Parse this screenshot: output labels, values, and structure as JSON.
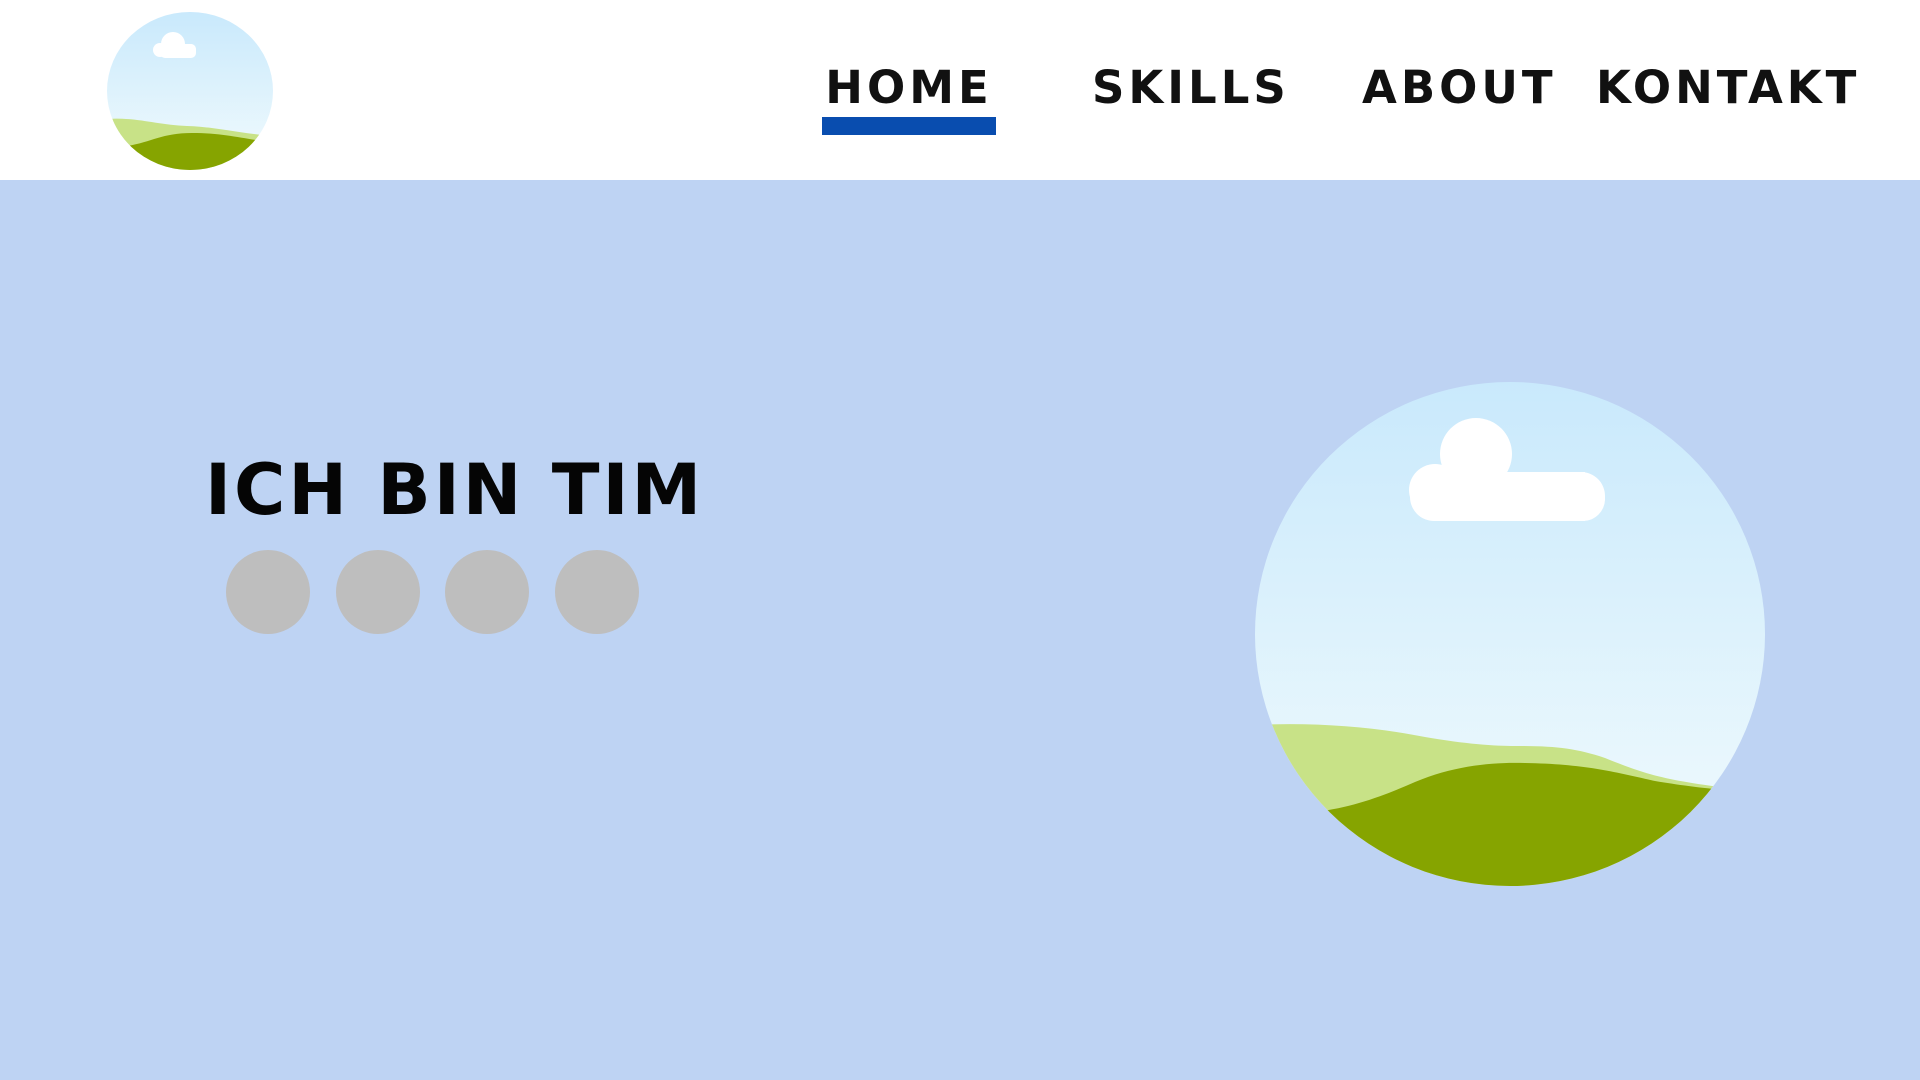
{
  "nav": {
    "items": [
      {
        "label": "HOME",
        "active": true
      },
      {
        "label": "SKILLS",
        "active": false
      },
      {
        "label": "ABOUT",
        "active": false
      },
      {
        "label": "KONTAKT",
        "active": false
      }
    ],
    "active_color": "#094daf"
  },
  "logo": {
    "icon": "landscape-image-icon"
  },
  "hero": {
    "title": "ICH BIN TIM",
    "background": "#bed3f3",
    "social_icons": [
      "placeholder-circle-icon",
      "placeholder-circle-icon",
      "placeholder-circle-icon",
      "placeholder-circle-icon"
    ],
    "image_icon": "landscape-image-icon"
  },
  "colors": {
    "sky_top": "#c9e9fc",
    "sky_bottom": "#f2fbfd",
    "hill_light": "#c8e287",
    "hill_dark": "#86a400",
    "cloud": "#ffffff",
    "dot": "#bebebe"
  }
}
